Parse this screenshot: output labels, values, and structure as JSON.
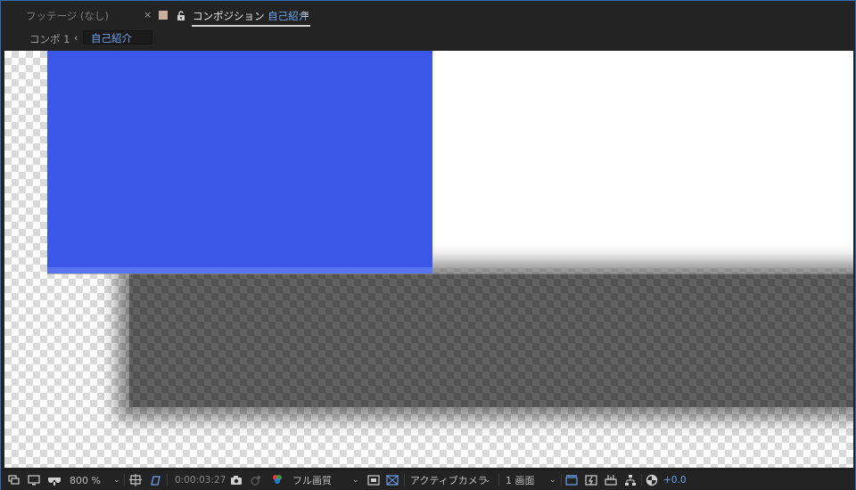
{
  "tabs": {
    "footage_label": "フッテージ (なし)",
    "close_glyph": "×",
    "composition_prefix": "コンポジション",
    "composition_name": "自己紹介",
    "menu_glyph": "≡"
  },
  "breadcrumb": {
    "parent": "コンポ 1",
    "arrow": "‹",
    "current": "自己紹介"
  },
  "toolbar": {
    "zoom": "800 %",
    "timecode": "0:00:03:27",
    "resolution": "フル画質",
    "camera": "アクティブカメラ",
    "views": "1 画面",
    "exposure": "+0.0",
    "chevron": "⌄"
  },
  "colors": {
    "accent": "#6aa1ec",
    "shape_fill": "#3a57e8",
    "panel_bg": "#232323",
    "frame_border": "#2e6db4"
  },
  "icons": {
    "tab_lock": "lock-open-icon",
    "comp_flowchart": "monitor-icon",
    "mask_visibility": "mask-icon",
    "region_of_interest": "region-of-interest-icon",
    "snapshot": "camera-icon",
    "show_snapshot": "show-snapshot-icon",
    "channel": "rgb-channel-icon",
    "transparency_grid": "transparency-grid-icon",
    "fast_preview": "fast-preview-icon",
    "timeline": "timeline-icon",
    "flowchart": "flowchart-icon",
    "reset_exposure": "reset-exposure-icon"
  }
}
